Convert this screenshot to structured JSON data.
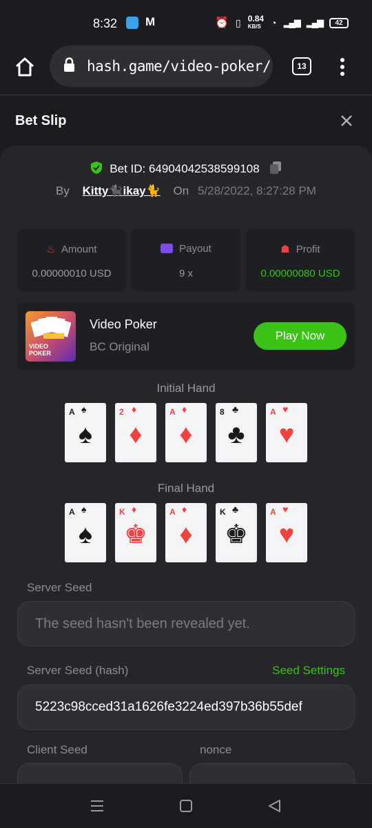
{
  "status": {
    "time": "8:32",
    "net_speed": "0.84",
    "net_unit": "KB/S",
    "battery": "42"
  },
  "browser": {
    "url": "hash.game/video-poker/",
    "tab_count": "13"
  },
  "header": {
    "title": "Bet Slip"
  },
  "bet": {
    "id_label": "Bet ID: 64904042538599108",
    "by_label": "By",
    "user": "Kitty🐈‍⬛ikay🐈",
    "on_label": "On",
    "date": "5/28/2022, 8:27:28 PM"
  },
  "stats": {
    "amount_label": "Amount",
    "amount_value": "0.00000010 USD",
    "payout_label": "Payout",
    "payout_value": "9 x",
    "profit_label": "Profit",
    "profit_value": "0.00000080 USD"
  },
  "game": {
    "thumb_text_1": "VIDEO",
    "thumb_text_2": "POKER",
    "name": "Video Poker",
    "subtitle": "BC Original",
    "play_label": "Play Now"
  },
  "initial_hand": {
    "label": "Initial Hand",
    "cards": [
      {
        "rank": "A",
        "suit": "♠"
      },
      {
        "rank": "2",
        "suit": "♦"
      },
      {
        "rank": "A",
        "suit": "♦"
      },
      {
        "rank": "8",
        "suit": "♣"
      },
      {
        "rank": "A",
        "suit": "♥"
      }
    ]
  },
  "final_hand": {
    "label": "Final Hand",
    "cards": [
      {
        "rank": "A",
        "suit": "♠"
      },
      {
        "rank": "K",
        "suit": "♦"
      },
      {
        "rank": "A",
        "suit": "♦"
      },
      {
        "rank": "K",
        "suit": "♣"
      },
      {
        "rank": "A",
        "suit": "♥"
      }
    ]
  },
  "seeds": {
    "server_seed_label": "Server Seed",
    "server_seed_value": "The seed hasn't been revealed yet.",
    "server_hash_label": "Server Seed (hash)",
    "seed_settings_label": "Seed Settings",
    "server_hash_value": "5223c98cced31a1626fe3224ed397b36b55def",
    "client_seed_label": "Client Seed",
    "nonce_label": "nonce"
  },
  "colors": {
    "accent": "#3bc117",
    "profit": "#3bc117",
    "panel": "#25262a",
    "red_suit": "#f0433f"
  }
}
